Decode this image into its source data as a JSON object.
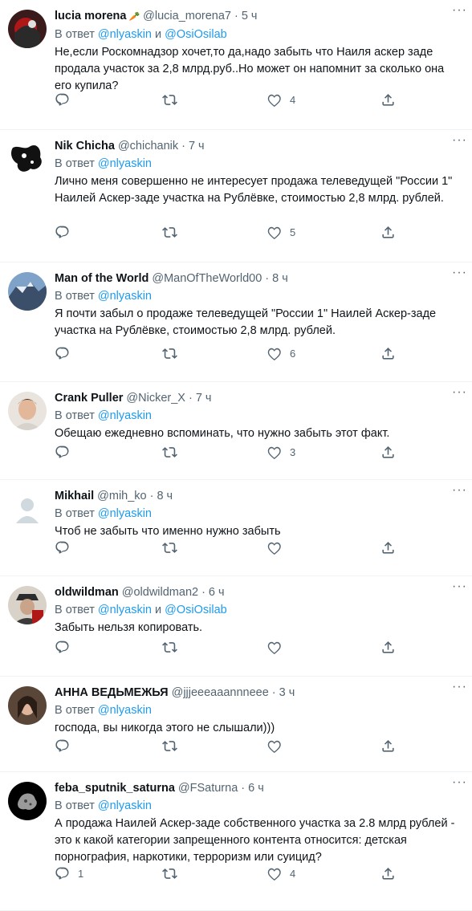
{
  "reply_prefix": "В ответ",
  "conjunction": "и",
  "more_glyph": "···",
  "colors": {
    "link": "#1d9bf0",
    "secondary": "#536471",
    "text": "#0f1419"
  },
  "icons": {
    "reply": "reply-icon",
    "retweet": "retweet-icon",
    "like": "like-icon",
    "share": "share-icon",
    "more": "more-icon"
  },
  "tweets": [
    {
      "name": "lucia morena",
      "badge": "🥕",
      "handle": "@lucia_morena7",
      "time": "5 ч",
      "mentions": [
        "@nlyaskin",
        "@OsiOsilab"
      ],
      "text": "Не,если Роскомнадзор хочет,то да,надо забыть что  Наиля аскер заде продала участок за 2,8 млрд.руб..Но может он напомнит за сколько она его купила?",
      "replies": "",
      "likes": "4"
    },
    {
      "name": "Nik Chicha",
      "badge": "",
      "handle": "@chichanik",
      "time": "7 ч",
      "mentions": [
        "@nlyaskin"
      ],
      "text": "Лично меня совершенно не интересует продажа телеведущей \"России 1\" Наилей Аскер-заде участка на Рублёвке, стоимостью 2,8 млрд. рублей.",
      "replies": "",
      "likes": "5"
    },
    {
      "name": "Man of the World",
      "badge": "",
      "handle": "@ManOfTheWorld00",
      "time": "8 ч",
      "mentions": [
        "@nlyaskin"
      ],
      "text": "Я почти забыл о продаже телеведущей \"России 1\" Наилей Аскер-заде участка на Рублёвке, стоимостью 2,8 млрд. рублей.",
      "replies": "",
      "likes": "6"
    },
    {
      "name": "Crank Puller",
      "badge": "",
      "handle": "@Nicker_X",
      "time": "7 ч",
      "mentions": [
        "@nlyaskin"
      ],
      "text": "Обещаю ежедневно вспоминать, что нужно забыть этот факт.",
      "replies": "",
      "likes": "3"
    },
    {
      "name": "Mikhail",
      "badge": "",
      "handle": "@mih_ko",
      "time": "8 ч",
      "mentions": [
        "@nlyaskin"
      ],
      "text": "Чтоб не забыть что именно нужно забыть",
      "replies": "",
      "likes": ""
    },
    {
      "name": "oldwildman",
      "badge": "",
      "handle": "@oldwildman2",
      "time": "6 ч",
      "mentions": [
        "@nlyaskin",
        "@OsiOsilab"
      ],
      "text": "Забыть нельзя копировать.",
      "replies": "",
      "likes": ""
    },
    {
      "name": "АННА ВЕДЬМЕЖЬЯ",
      "badge": "",
      "handle": "@jjjeeeaaannneee",
      "time": "3 ч",
      "mentions": [
        "@nlyaskin"
      ],
      "text": "господа, вы никогда этого не слышали)))",
      "replies": "",
      "likes": ""
    },
    {
      "name": "feba_sputnik_saturna",
      "badge": "",
      "handle": "@FSaturna",
      "time": "6 ч",
      "mentions": [
        "@nlyaskin"
      ],
      "text": "А продажа Наилей Аскер-заде собственного участка за 2.8 млрд рублей - это к какой категории запрещенного контента относится: детская порнография, наркотики, терроризм или суицид?",
      "replies": "1",
      "likes": "4"
    }
  ]
}
